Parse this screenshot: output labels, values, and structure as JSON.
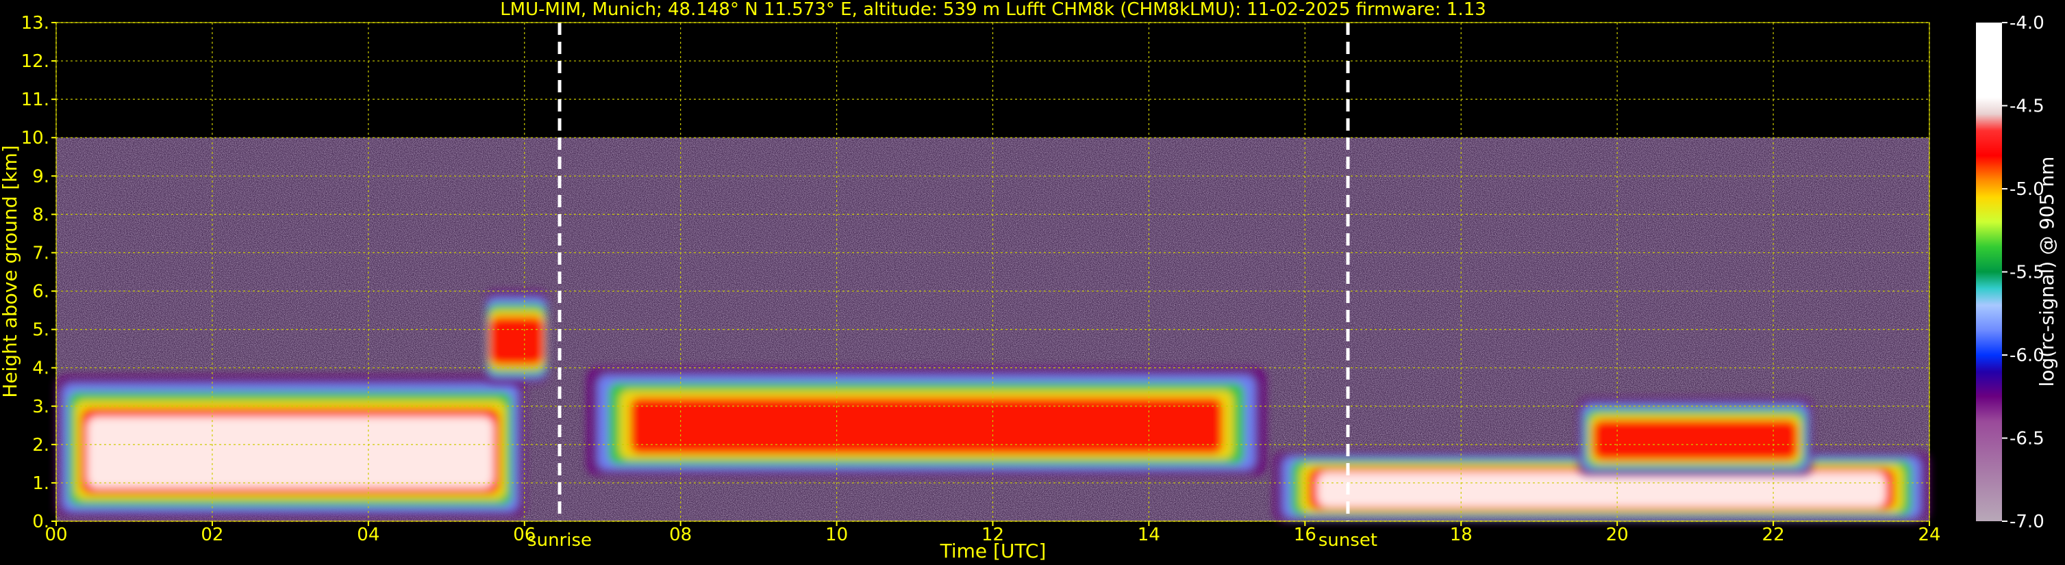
{
  "chart_data": {
    "type": "heatmap",
    "title": "LMU-MIM, Munich; 48.148° N 11.573° E, altitude: 539 m    Lufft CHM8k (CHM8kLMU): 11-02-2025    firmware: 1.13",
    "xlabel": "Time [UTC]",
    "ylabel": "Height above ground [km]",
    "xlim": [
      0,
      24
    ],
    "ylim": [
      0,
      13
    ],
    "x_ticks": [
      "00",
      "02",
      "04",
      "06",
      "08",
      "10",
      "12",
      "14",
      "16",
      "18",
      "20",
      "22",
      "24"
    ],
    "y_ticks": [
      "0.",
      "1.",
      "2.",
      "3.",
      "4.",
      "5.",
      "6.",
      "7.",
      "8.",
      "9.",
      "10.",
      "11.",
      "12.",
      "13."
    ],
    "grid": true,
    "grid_color": "#cccc00",
    "data_ceiling_km": 10,
    "annotations": [
      {
        "label": "sunrise",
        "x": 6.45
      },
      {
        "label": "sunset",
        "x": 16.55
      }
    ],
    "colorbar": {
      "label": "log(rc-signal) @ 905 nm",
      "min": -7.0,
      "max": -4.0,
      "ticks": [
        "-4.0",
        "-4.5",
        "-5.0",
        "-5.5",
        "-6.0",
        "-6.5",
        "-7.0"
      ],
      "stops": [
        {
          "v": -4.0,
          "color": "#ffffff"
        },
        {
          "v": -4.45,
          "color": "#ffffff"
        },
        {
          "v": -4.55,
          "color": "#e8d0d0"
        },
        {
          "v": -4.65,
          "color": "#ff3030"
        },
        {
          "v": -4.8,
          "color": "#ff0000"
        },
        {
          "v": -4.95,
          "color": "#ff8c00"
        },
        {
          "v": -5.05,
          "color": "#ffd700"
        },
        {
          "v": -5.2,
          "color": "#ccff33"
        },
        {
          "v": -5.35,
          "color": "#33cc33"
        },
        {
          "v": -5.5,
          "color": "#009944"
        },
        {
          "v": -5.6,
          "color": "#33cccc"
        },
        {
          "v": -5.7,
          "color": "#a8c8ff"
        },
        {
          "v": -5.85,
          "color": "#6e8cff"
        },
        {
          "v": -6.0,
          "color": "#0033ff"
        },
        {
          "v": -6.1,
          "color": "#2200aa"
        },
        {
          "v": -6.25,
          "color": "#6a0080"
        },
        {
          "v": -6.4,
          "color": "#9a4a9a"
        },
        {
          "v": -6.7,
          "color": "#a87aa8"
        },
        {
          "v": -7.0,
          "color": "#b8a8b8"
        }
      ]
    },
    "features": [
      {
        "name": "boundary-layer-morning",
        "x0": 0.0,
        "x1": 6.0,
        "y0": 0.1,
        "y1": 3.8,
        "level": "high"
      },
      {
        "name": "aerosol-layer-day",
        "x0": 6.8,
        "x1": 15.5,
        "y0": 1.2,
        "y1": 4.0,
        "level": "mid"
      },
      {
        "name": "surface-layer-evening",
        "x0": 15.6,
        "x1": 24.0,
        "y0": 0.0,
        "y1": 1.8,
        "level": "high"
      },
      {
        "name": "elevated-layer-evening",
        "x0": 19.5,
        "x1": 22.5,
        "y0": 1.2,
        "y1": 3.2,
        "level": "mid"
      },
      {
        "name": "plume-0530",
        "x0": 5.5,
        "x1": 6.3,
        "y0": 3.6,
        "y1": 6.0,
        "level": "mid"
      }
    ]
  }
}
